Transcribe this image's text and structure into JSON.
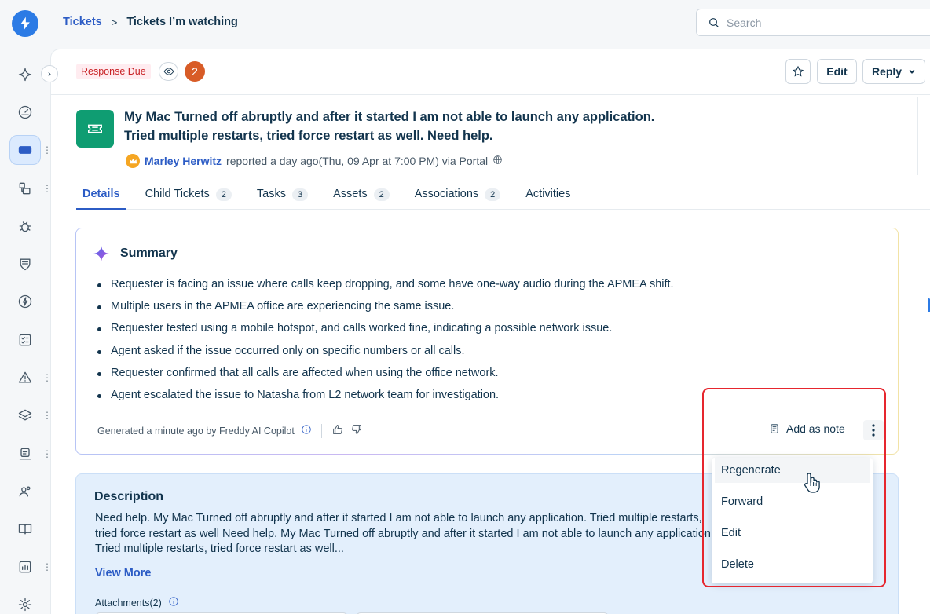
{
  "breadcrumb": {
    "root": "Tickets",
    "separator": ">",
    "current": "Tickets I’m watching"
  },
  "search": {
    "placeholder": "Search"
  },
  "ticket_header": {
    "status_badge": "Response Due",
    "watchers_count": "2",
    "edit_label": "Edit",
    "reply_label": "Reply"
  },
  "ticket": {
    "title": "My Mac Turned off abruptly and after it started I am not able to launch any application. Tried multiple restarts, tried force restart as well. Need help.",
    "reporter_name": "Marley Herwitz",
    "reported_text": "reported a day ago(Thu, 09 Apr at 7:00 PM) via Portal"
  },
  "tabs": [
    {
      "label": "Details",
      "count": ""
    },
    {
      "label": "Child Tickets",
      "count": "2"
    },
    {
      "label": "Tasks",
      "count": "3"
    },
    {
      "label": "Assets",
      "count": "2"
    },
    {
      "label": "Associations",
      "count": "2"
    },
    {
      "label": "Activities",
      "count": ""
    }
  ],
  "summary": {
    "title": "Summary",
    "items": [
      "Requester is facing an issue where calls keep dropping, and some have one-way audio during the APMEA shift.",
      "Multiple users in the APMEA office are experiencing the same issue.",
      "Requester tested using a mobile hotspot, and calls worked fine, indicating a possible network issue.",
      "Agent asked if the issue occurred only on specific numbers or all calls.",
      "Requester confirmed that all calls are affected when using the office network.",
      "Agent escalated the issue to Natasha from L2 network team for investigation."
    ],
    "generated_text": "Generated a minute ago by Freddy AI Copilot",
    "add_note_label": "Add as note"
  },
  "menu": {
    "items": [
      "Regenerate",
      "Forward",
      "Edit",
      "Delete"
    ]
  },
  "description": {
    "title": "Description",
    "body": "Need help. My Mac Turned off abruptly and after it started I am not able to launch any application. Tried multiple restarts, tried force restart as well Need help. My Mac Turned off abruptly and after it started I am not able to launch any application. Tried multiple restarts, tried force restart as well...",
    "view_more": "View More",
    "attachments_label": "Attachments(2)"
  },
  "colors": {
    "accent": "#2c5cc5",
    "ticket_icon": "#0f9d72",
    "badge_due_bg": "#ffecf0",
    "badge_due_text": "#c82124",
    "watch_count_bg": "#d85c27",
    "highlight_border": "#e6262e"
  },
  "icons": {
    "logo": "freshservice-bolt-icon",
    "rail": [
      "copilot-sparkle-icon",
      "dashboard-gauge-icon",
      "tickets-icon",
      "problems-icon",
      "bug-icon",
      "shield-icon",
      "lightning-icon",
      "checklist-icon",
      "alert-icon",
      "layers-icon",
      "assets-icon",
      "users-icon",
      "book-icon",
      "reports-icon",
      "settings-icon"
    ]
  }
}
